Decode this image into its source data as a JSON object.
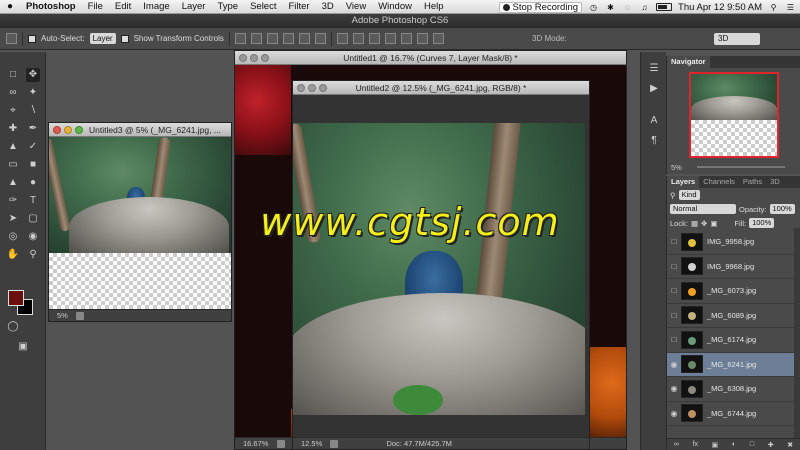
{
  "menubar": {
    "apple": "",
    "items": [
      "Photoshop",
      "File",
      "Edit",
      "Image",
      "Layer",
      "Type",
      "Select",
      "Filter",
      "3D",
      "View",
      "Window",
      "Help"
    ],
    "recording": "Stop Recording",
    "clock": "Thu Apr 12  9:50 AM"
  },
  "app_title": "Adobe Photoshop CS6",
  "options": {
    "auto_select": "Auto-Select:",
    "auto_select_target": "Layer",
    "show_transform": "Show Transform Controls",
    "mode_3d": "3D Mode:",
    "workspace": "3D"
  },
  "documents": {
    "doc1": {
      "title": "Untitled1 @ 16.7% (Curves 7, Layer Mask/8) *",
      "zoom": "16.67%"
    },
    "doc2": {
      "title": "Untitled2 @ 12.5% (_MG_6241.jpg, RGB/8) *",
      "zoom": "12.5%",
      "doc_info": "Doc: 47.7M/425.7M"
    },
    "doc3": {
      "title": "Untitled3 @ 5% (_MG_6241.jpg, ...",
      "zoom": "5%"
    }
  },
  "watermark": "www.cgtsj.com",
  "navigator": {
    "tab": "Navigator",
    "zoom": "5%"
  },
  "layers": {
    "tabs": [
      "Layers",
      "Channels",
      "Paths",
      "3D"
    ],
    "kind": "Kind",
    "blend": "Normal",
    "opacity_label": "Opacity:",
    "opacity": "100%",
    "lock_label": "Lock:",
    "fill_label": "Fill:",
    "fill": "100%",
    "items": [
      {
        "name": "IMG_9958.jpg",
        "visible": false,
        "selected": false
      },
      {
        "name": "IMG_9968.jpg",
        "visible": false,
        "selected": false
      },
      {
        "name": "_MG_6073.jpg",
        "visible": false,
        "selected": false
      },
      {
        "name": "_MG_6089.jpg",
        "visible": false,
        "selected": false
      },
      {
        "name": "_MG_6174.jpg",
        "visible": false,
        "selected": false
      },
      {
        "name": "_MG_6241.jpg",
        "visible": true,
        "selected": true
      },
      {
        "name": "_MG_6308.jpg",
        "visible": true,
        "selected": false
      },
      {
        "name": "_MG_6744.jpg",
        "visible": true,
        "selected": false
      }
    ]
  }
}
